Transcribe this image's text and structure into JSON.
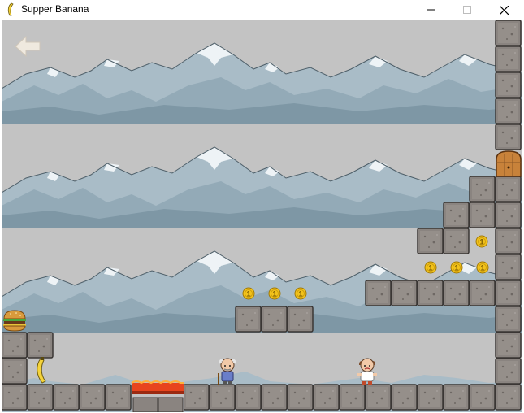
{
  "window": {
    "title": "Supper Banana",
    "app_icon": "banana-icon",
    "controls": {
      "minimize_icon": "minimize-icon",
      "maximize_icon": "maximize-icon",
      "close_icon": "close-icon"
    }
  },
  "game": {
    "back_button_icon": "back-arrow-icon",
    "background": "snowy-mountains",
    "items": {
      "coins_icon": "gold-coin-icon",
      "coin_label": "1",
      "burger_icon": "hamburger-icon",
      "banana_icon": "banana-icon",
      "door_icon": "wooden-door-icon",
      "lava_icon": "lava-pit-icon",
      "player_icon": "old-man-with-cane-icon",
      "enemy_icon": "bald-man-icon"
    },
    "colors": {
      "sky": "#c3c3c3",
      "mountain": "#a9bcc7",
      "mountain_dark": "#7e97a5",
      "snow": "#eef3f6",
      "stone": "#8a8480",
      "coin": "#f2c21a",
      "lava": "#e8451e"
    }
  }
}
